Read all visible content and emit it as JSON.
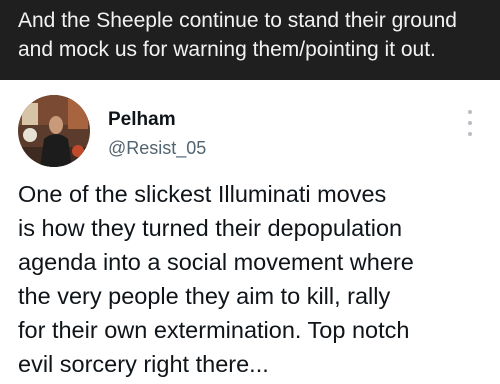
{
  "caption": {
    "lines": [
      "And the Sheeple continue to stand their ground",
      "and mock us for warning them/pointing it out."
    ]
  },
  "tweet": {
    "author_name": "Pelham",
    "author_handle": "@Resist_05",
    "avatar_icon": "profile-photo",
    "more_icon": "more-vertical-icon",
    "text_lines": [
      "One of the slickest Illuminati moves",
      "is how they turned their depopulation",
      "agenda into a social movement where",
      "the very people they aim to kill, rally",
      "for their own extermination. Top notch",
      "evil sorcery right there..."
    ]
  },
  "colors": {
    "caption_bg": "#1f1f1f",
    "caption_text": "#f2f2f2",
    "tweet_bg": "#ffffff",
    "name_text": "#0f1419",
    "handle_text": "#536471"
  }
}
